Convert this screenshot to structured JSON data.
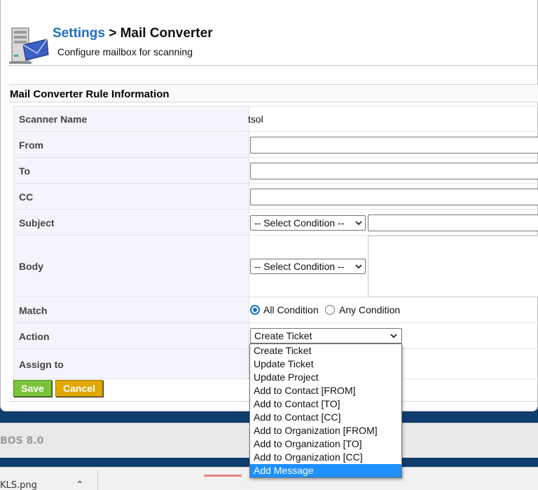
{
  "header": {
    "breadcrumb_link": "Settings",
    "breadcrumb_sep": " > ",
    "breadcrumb_current": "Mail Converter",
    "subtitle": "Configure mailbox for scanning"
  },
  "section": {
    "title": "Mail Converter Rule Information"
  },
  "form": {
    "scanner_name_label": "Scanner Name",
    "scanner_name_value": "tsol",
    "from_label": "From",
    "to_label": "To",
    "cc_label": "CC",
    "subject_label": "Subject",
    "subject_condition": "-- Select Condition --",
    "body_label": "Body",
    "body_condition": "-- Select Condition --",
    "match_label": "Match",
    "match_all": "All Condition",
    "match_any": "Any Condition",
    "match_selected": "All Condition",
    "action_label": "Action",
    "action_value": "Create Ticket",
    "assign_label": "Assign to"
  },
  "buttons": {
    "save": "Save",
    "cancel": "Cancel"
  },
  "action_options": [
    "Create Ticket",
    "Update Ticket",
    "Update Project",
    "Add to Contact [FROM]",
    "Add to Contact [TO]",
    "Add to Contact [CC]",
    "Add to Organization [FROM]",
    "Add to Organization [TO]",
    "Add to Organization [CC]",
    "Add Message"
  ],
  "action_highlighted": "Add Message",
  "footer": {
    "version_text": "BOS 8.0"
  },
  "taskbar": {
    "file_name": "KLS.png"
  },
  "colors": {
    "link": "#1a6fc4",
    "save": "#7cc23a",
    "cancel": "#e0a800",
    "highlight": "#1e90ff"
  }
}
